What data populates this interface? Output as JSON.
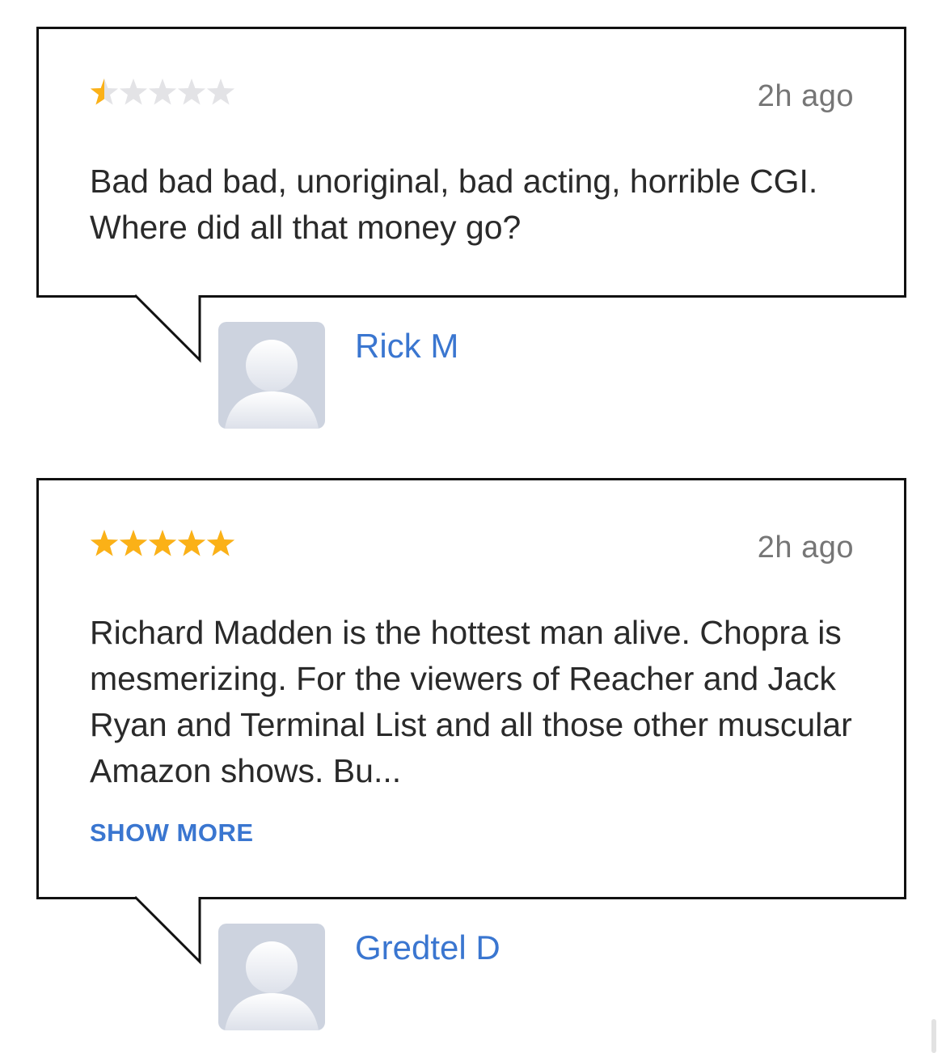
{
  "colors": {
    "star_filled": "#fbb117",
    "star_empty": "#e3e3e6",
    "link": "#3a76d0",
    "border": "#111111",
    "avatar_bg": "#cdd3df"
  },
  "reviews": [
    {
      "rating": 0.5,
      "max_rating": 5,
      "time": "2h ago",
      "text": "Bad bad bad, unoriginal, bad acting, horrible CGI. Where did all that money go?",
      "show_more": "",
      "author": "Rick M",
      "avatar_icon": "default-user-avatar-icon"
    },
    {
      "rating": 5,
      "max_rating": 5,
      "time": "2h ago",
      "text": "Richard Madden is the hottest man alive. Chopra is mesmerizing. For the viewers of Reacher and Jack Ryan and Terminal List and all those other muscular Amazon shows. Bu...",
      "show_more": "SHOW MORE",
      "author": "Gredtel D",
      "avatar_icon": "default-user-avatar-icon"
    }
  ]
}
